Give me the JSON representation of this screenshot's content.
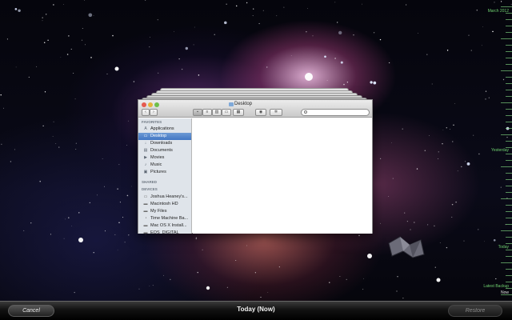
{
  "timeline": {
    "labels": [
      "March 2012",
      "Yesterday",
      "Today",
      "Latest Backup"
    ],
    "now_label": "Now"
  },
  "finder": {
    "title": "Desktop",
    "traffic_colors": [
      "#e55a4f",
      "#e4b43b",
      "#6fbf4a"
    ],
    "toolbar": {
      "back_icon": "chevron-left-icon",
      "forward_icon": "chevron-right-icon",
      "views": [
        "icon-view-icon",
        "list-view-icon",
        "column-view-icon",
        "cover-flow-icon"
      ],
      "arrange_icon": "arrange-icon",
      "quicklook_icon": "eye-icon",
      "action_icon": "gear-icon",
      "search_placeholder": ""
    },
    "sidebar": {
      "favorites_header": "FAVORITES",
      "favorites": [
        {
          "label": "Applications",
          "icon": "applications-icon",
          "selected": false
        },
        {
          "label": "Desktop",
          "icon": "desktop-icon",
          "selected": true
        },
        {
          "label": "Downloads",
          "icon": "downloads-icon",
          "selected": false
        },
        {
          "label": "Documents",
          "icon": "documents-icon",
          "selected": false
        },
        {
          "label": "Movies",
          "icon": "movies-icon",
          "selected": false
        },
        {
          "label": "Music",
          "icon": "music-icon",
          "selected": false
        },
        {
          "label": "Pictures",
          "icon": "pictures-icon",
          "selected": false
        }
      ],
      "shared_header": "SHARED",
      "devices_header": "DEVICES",
      "devices": [
        {
          "label": "Joshua Heaney's...",
          "icon": "computer-icon"
        },
        {
          "label": "Macintosh HD",
          "icon": "hard-drive-icon"
        },
        {
          "label": "My Files",
          "icon": "drive-icon"
        },
        {
          "label": "Time Machine Ba...",
          "icon": "time-machine-drive-icon"
        },
        {
          "label": "Mac OS X Install...",
          "icon": "drive-icon"
        },
        {
          "label": "EOS_DIGITAL",
          "icon": "drive-icon"
        }
      ]
    }
  },
  "bottombar": {
    "cancel_label": "Cancel",
    "title": "Today (Now)",
    "restore_label": "Restore"
  }
}
